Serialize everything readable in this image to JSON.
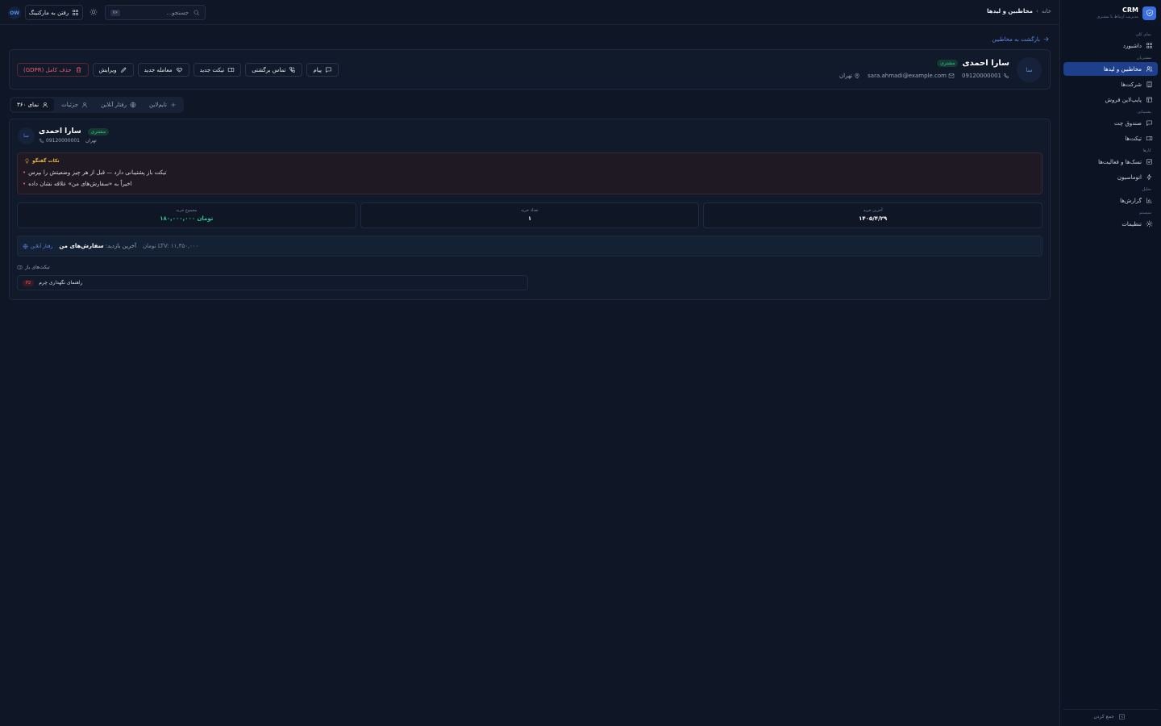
{
  "brand": {
    "title": "CRM",
    "subtitle": "مدیریت ارتباط با مشتری"
  },
  "sidebar": {
    "groups": [
      {
        "label": "نمای کلی",
        "items": [
          {
            "label": "داشبورد",
            "icon": "grid-icon"
          }
        ]
      },
      {
        "label": "مشتریان",
        "items": [
          {
            "label": "مخاطبین و لیدها",
            "icon": "users-icon",
            "active": true
          },
          {
            "label": "شرکت‌ها",
            "icon": "building-icon"
          },
          {
            "label": "پایپ‌لاین فروش",
            "icon": "pipeline-icon"
          }
        ]
      },
      {
        "label": "پشتیبانی",
        "items": [
          {
            "label": "صندوق چت",
            "icon": "chat-icon"
          },
          {
            "label": "تیکت‌ها",
            "icon": "ticket-icon"
          }
        ]
      },
      {
        "label": "کارها",
        "items": [
          {
            "label": "تسک‌ها و فعالیت‌ها",
            "icon": "check-icon"
          },
          {
            "label": "اتوماسیون",
            "icon": "bolt-icon"
          }
        ]
      },
      {
        "label": "تحلیل",
        "items": [
          {
            "label": "گزارش‌ها",
            "icon": "chart-icon"
          }
        ]
      },
      {
        "label": "سیستم",
        "items": [
          {
            "label": "تنظیمات",
            "icon": "gear-icon"
          }
        ]
      }
    ],
    "collapse_label": "جمع کردن"
  },
  "topbar": {
    "breadcrumb_home": "خانه",
    "breadcrumb_sep": "›",
    "breadcrumb_current": "مخاطبین و لیدها",
    "search_placeholder": "جستجو...",
    "search_kbd": "⌘K",
    "marketing_label": "رفتن به مارکتینگ",
    "user_initials": "OW"
  },
  "contact": {
    "back_label": "بازگشت به مخاطبین",
    "avatar": "سا",
    "name": "سارا احمدی",
    "badge": "مشتری",
    "phone": "09120000001",
    "email": "sara.ahmadi@example.com",
    "city": "تهران"
  },
  "actions": {
    "message": "پیام",
    "call": "تماس برگشتی",
    "ticket": "تیکت جدید",
    "deal": "معامله جدید",
    "edit": "ویرایش",
    "delete": "حذف کامل (GDPR)"
  },
  "tabs": {
    "view360": "نمای ۳۶۰",
    "details": "جزئیات",
    "online": "رفتار آنلاین",
    "timeline": "تایم‌لاین"
  },
  "tips": {
    "title": "نکات گفتگو",
    "items": [
      "تیکت باز پشتیبانی دارد — قبل از هر چیز وضعیتش را بپرس",
      "اخیراً به «سفارش‌های من» علاقه نشان داده"
    ]
  },
  "stats": [
    {
      "label": "مجموع خرید",
      "value": "۱۸۰,۰۰۰,۰۰۰ تومان",
      "green": true
    },
    {
      "label": "تعداد خرید",
      "value": "۱"
    },
    {
      "label": "آخرین خرید",
      "value": "۱۴۰۵/۴/۲۹"
    }
  ],
  "online": {
    "link": "رفتار آنلاین",
    "last_visit_label": "آخرین بازدید:",
    "last_visit_page": "سفارش‌های من",
    "ltv": "LTV: ۱۱,۳۵۰,۰۰۰ تومان"
  },
  "open_tickets": {
    "title": "تیکت‌های باز",
    "items": [
      {
        "title": "راهنمای نگهداری چرم",
        "priority": "P2"
      }
    ]
  },
  "colors": {
    "accent": "#3b6fe0",
    "success": "#34c38f",
    "danger": "#ef5a6f",
    "warning": "#f0b43c",
    "background": "#0f1626"
  }
}
